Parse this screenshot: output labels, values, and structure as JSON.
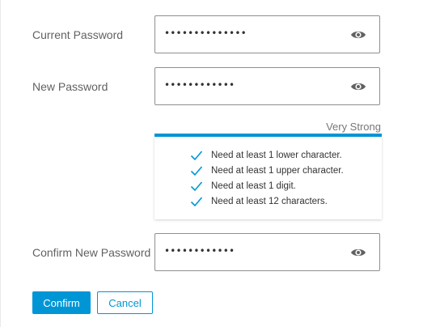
{
  "current_password": {
    "label": "Current Password",
    "masked_value": "••••••••••••••"
  },
  "new_password": {
    "label": "New Password",
    "masked_value": "••••••••••••"
  },
  "strength": {
    "label": "Very Strong",
    "color": "#0096d6",
    "level": 1.0
  },
  "rules": [
    {
      "text": "Need at least 1 lower character.",
      "satisfied": true
    },
    {
      "text": "Need at least 1 upper character.",
      "satisfied": true
    },
    {
      "text": "Need at least 1 digit.",
      "satisfied": true
    },
    {
      "text": "Need at least 12 characters.",
      "satisfied": true
    }
  ],
  "confirm_password": {
    "label": "Confirm New Password",
    "masked_value": "••••••••••••"
  },
  "buttons": {
    "confirm_label": "Confirm",
    "cancel_label": "Cancel"
  },
  "colors": {
    "accent": "#0096d6",
    "border": "#8f8f8f"
  },
  "icons": {
    "show_password": "eye-icon",
    "rule_met": "checkmark-icon"
  }
}
